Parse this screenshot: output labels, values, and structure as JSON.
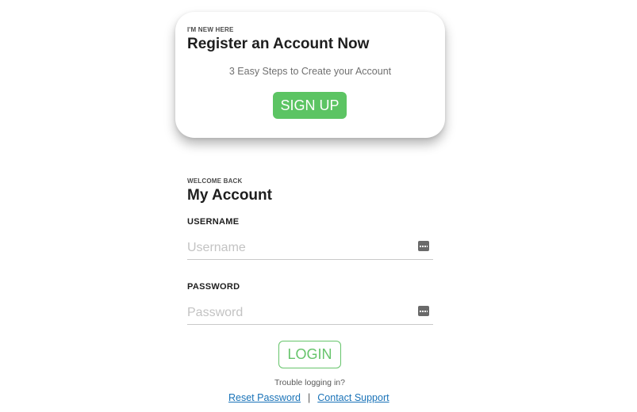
{
  "register": {
    "eyebrow": "I'M NEW HERE",
    "title": "Register an Account Now",
    "subtitle": "3 Easy Steps to Create your Account",
    "signup_label": "SIGN UP"
  },
  "login": {
    "eyebrow": "WELCOME BACK",
    "title": "My Account",
    "username": {
      "label": "USERNAME",
      "placeholder": "Username",
      "value": "",
      "icon": "credential-key-icon"
    },
    "password": {
      "label": "PASSWORD",
      "placeholder": "Password",
      "value": "",
      "icon": "credential-key-icon"
    },
    "login_label": "LOGIN",
    "trouble_text": "Trouble logging in?",
    "reset_link": "Reset Password",
    "separator": "|",
    "support_link": "Contact Support"
  },
  "colors": {
    "accent_green": "#5cc463",
    "link_blue": "#1a73b8"
  }
}
